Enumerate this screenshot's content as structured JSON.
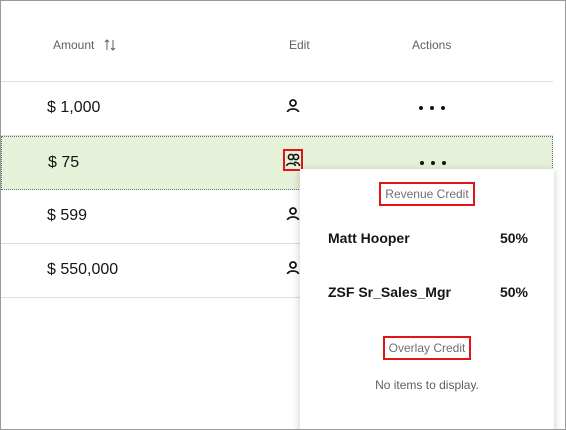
{
  "table": {
    "columns": {
      "amount": "Amount",
      "edit": "Edit",
      "actions": "Actions"
    },
    "rows": [
      {
        "amount": "$ 1,000",
        "selected": false,
        "edit_icon": "person-icon"
      },
      {
        "amount": "$ 75",
        "selected": true,
        "edit_icon": "people-icon"
      },
      {
        "amount": "$ 599",
        "selected": false,
        "edit_icon": "person-icon"
      },
      {
        "amount": "$ 550,000",
        "selected": false,
        "edit_icon": "person-icon"
      }
    ]
  },
  "popup": {
    "revenue_title": "Revenue Credit",
    "revenue_credits": [
      {
        "name": "Matt Hooper",
        "percent": "50%"
      },
      {
        "name": "ZSF Sr_Sales_Mgr",
        "percent": "50%"
      }
    ],
    "overlay_title": "Overlay Credit",
    "overlay_empty": "No items to display."
  },
  "colors": {
    "selected_row": "#e6f1d9",
    "highlight": "#e01616"
  }
}
